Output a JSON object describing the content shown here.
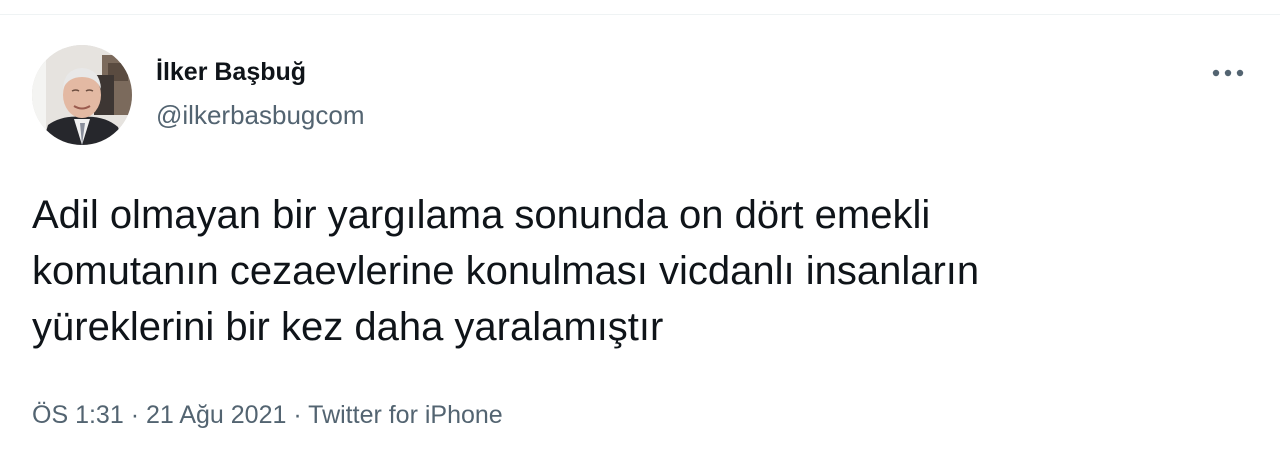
{
  "author": {
    "display_name": "İlker Başbuğ",
    "handle": "@ilkerbasbugcom"
  },
  "tweet": {
    "text": "Adil olmayan bir yargılama sonunda on dört emekli\nkomutanın cezaevlerine konulması vicdanlı insanların\nyüreklerini bir kez daha yaralamıştır",
    "time": "ÖS 1:31",
    "separator": "·",
    "date": "21 Ağu 2021",
    "source": "Twitter for iPhone"
  },
  "icons": {
    "more": "more-horizontal-icon"
  },
  "colors": {
    "primary_text": "#0f1419",
    "secondary_text": "#536471",
    "divider": "#eff3f4"
  }
}
